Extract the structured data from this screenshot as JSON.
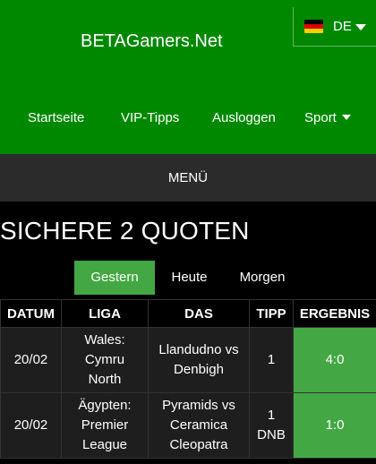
{
  "header": {
    "brand": "BETAGamers.Net",
    "language": {
      "code": "DE",
      "flag_colors": [
        "#000000",
        "#dd0000",
        "#ffce00"
      ]
    },
    "nav": [
      {
        "label": "Startseite"
      },
      {
        "label": "VIP-Tipps"
      },
      {
        "label": "Ausloggen"
      },
      {
        "label": "Sport"
      }
    ]
  },
  "menu_label": "MENÜ",
  "page_title": "SICHERE 2 QUOTEN",
  "tabs": [
    {
      "label": "Gestern",
      "active": true
    },
    {
      "label": "Heute",
      "active": false
    },
    {
      "label": "Morgen",
      "active": false
    }
  ],
  "table": {
    "columns": [
      "DATUM",
      "LIGA",
      "DAS",
      "TIPP",
      "ERGEBNIS"
    ],
    "rows": [
      {
        "date": "20/02",
        "league": [
          "Wales:",
          "Cymru",
          "North"
        ],
        "match": [
          "Llandudno vs",
          "Denbigh"
        ],
        "tip": [
          "1"
        ],
        "result": "4:0"
      },
      {
        "date": "20/02",
        "league": [
          "Ägypten:",
          "Premier",
          "League"
        ],
        "match": [
          "Pyramids vs",
          "Ceramica",
          "Cleopatra"
        ],
        "tip": [
          "1",
          "DNB"
        ],
        "result": "1:0"
      }
    ]
  },
  "colors": {
    "header_green": "#008800",
    "active_green": "#43a843",
    "menu_bar": "#2b2b2b",
    "background": "#000000"
  }
}
